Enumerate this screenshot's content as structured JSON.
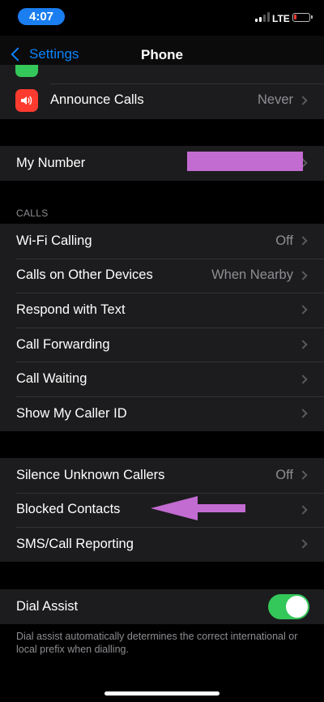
{
  "status": {
    "time": "4:07",
    "network": "LTE"
  },
  "nav": {
    "back_label": "Settings",
    "title": "Phone"
  },
  "group_top": {
    "rows": [
      {
        "label": "",
        "value": ""
      },
      {
        "label": "Announce Calls",
        "value": "Never"
      }
    ]
  },
  "group_number": {
    "label": "My Number"
  },
  "calls_section": {
    "header": "CALLS",
    "rows": [
      {
        "label": "Wi-Fi Calling",
        "value": "Off"
      },
      {
        "label": "Calls on Other Devices",
        "value": "When Nearby"
      },
      {
        "label": "Respond with Text",
        "value": ""
      },
      {
        "label": "Call Forwarding",
        "value": ""
      },
      {
        "label": "Call Waiting",
        "value": ""
      },
      {
        "label": "Show My Caller ID",
        "value": ""
      }
    ]
  },
  "blocking_section": {
    "rows": [
      {
        "label": "Silence Unknown Callers",
        "value": "Off"
      },
      {
        "label": "Blocked Contacts",
        "value": ""
      },
      {
        "label": "SMS/Call Reporting",
        "value": ""
      }
    ]
  },
  "dial_assist": {
    "label": "Dial Assist",
    "enabled": true,
    "note": "Dial assist automatically determines the correct international or local prefix when dialling."
  },
  "colors": {
    "accent": "#0a84ff",
    "toggle_on": "#34c759",
    "annotation": "#c26bd1"
  },
  "icons": {
    "back": "chevron-left-icon",
    "announce": "speaker-icon",
    "disclosure": "chevron-right-icon"
  }
}
